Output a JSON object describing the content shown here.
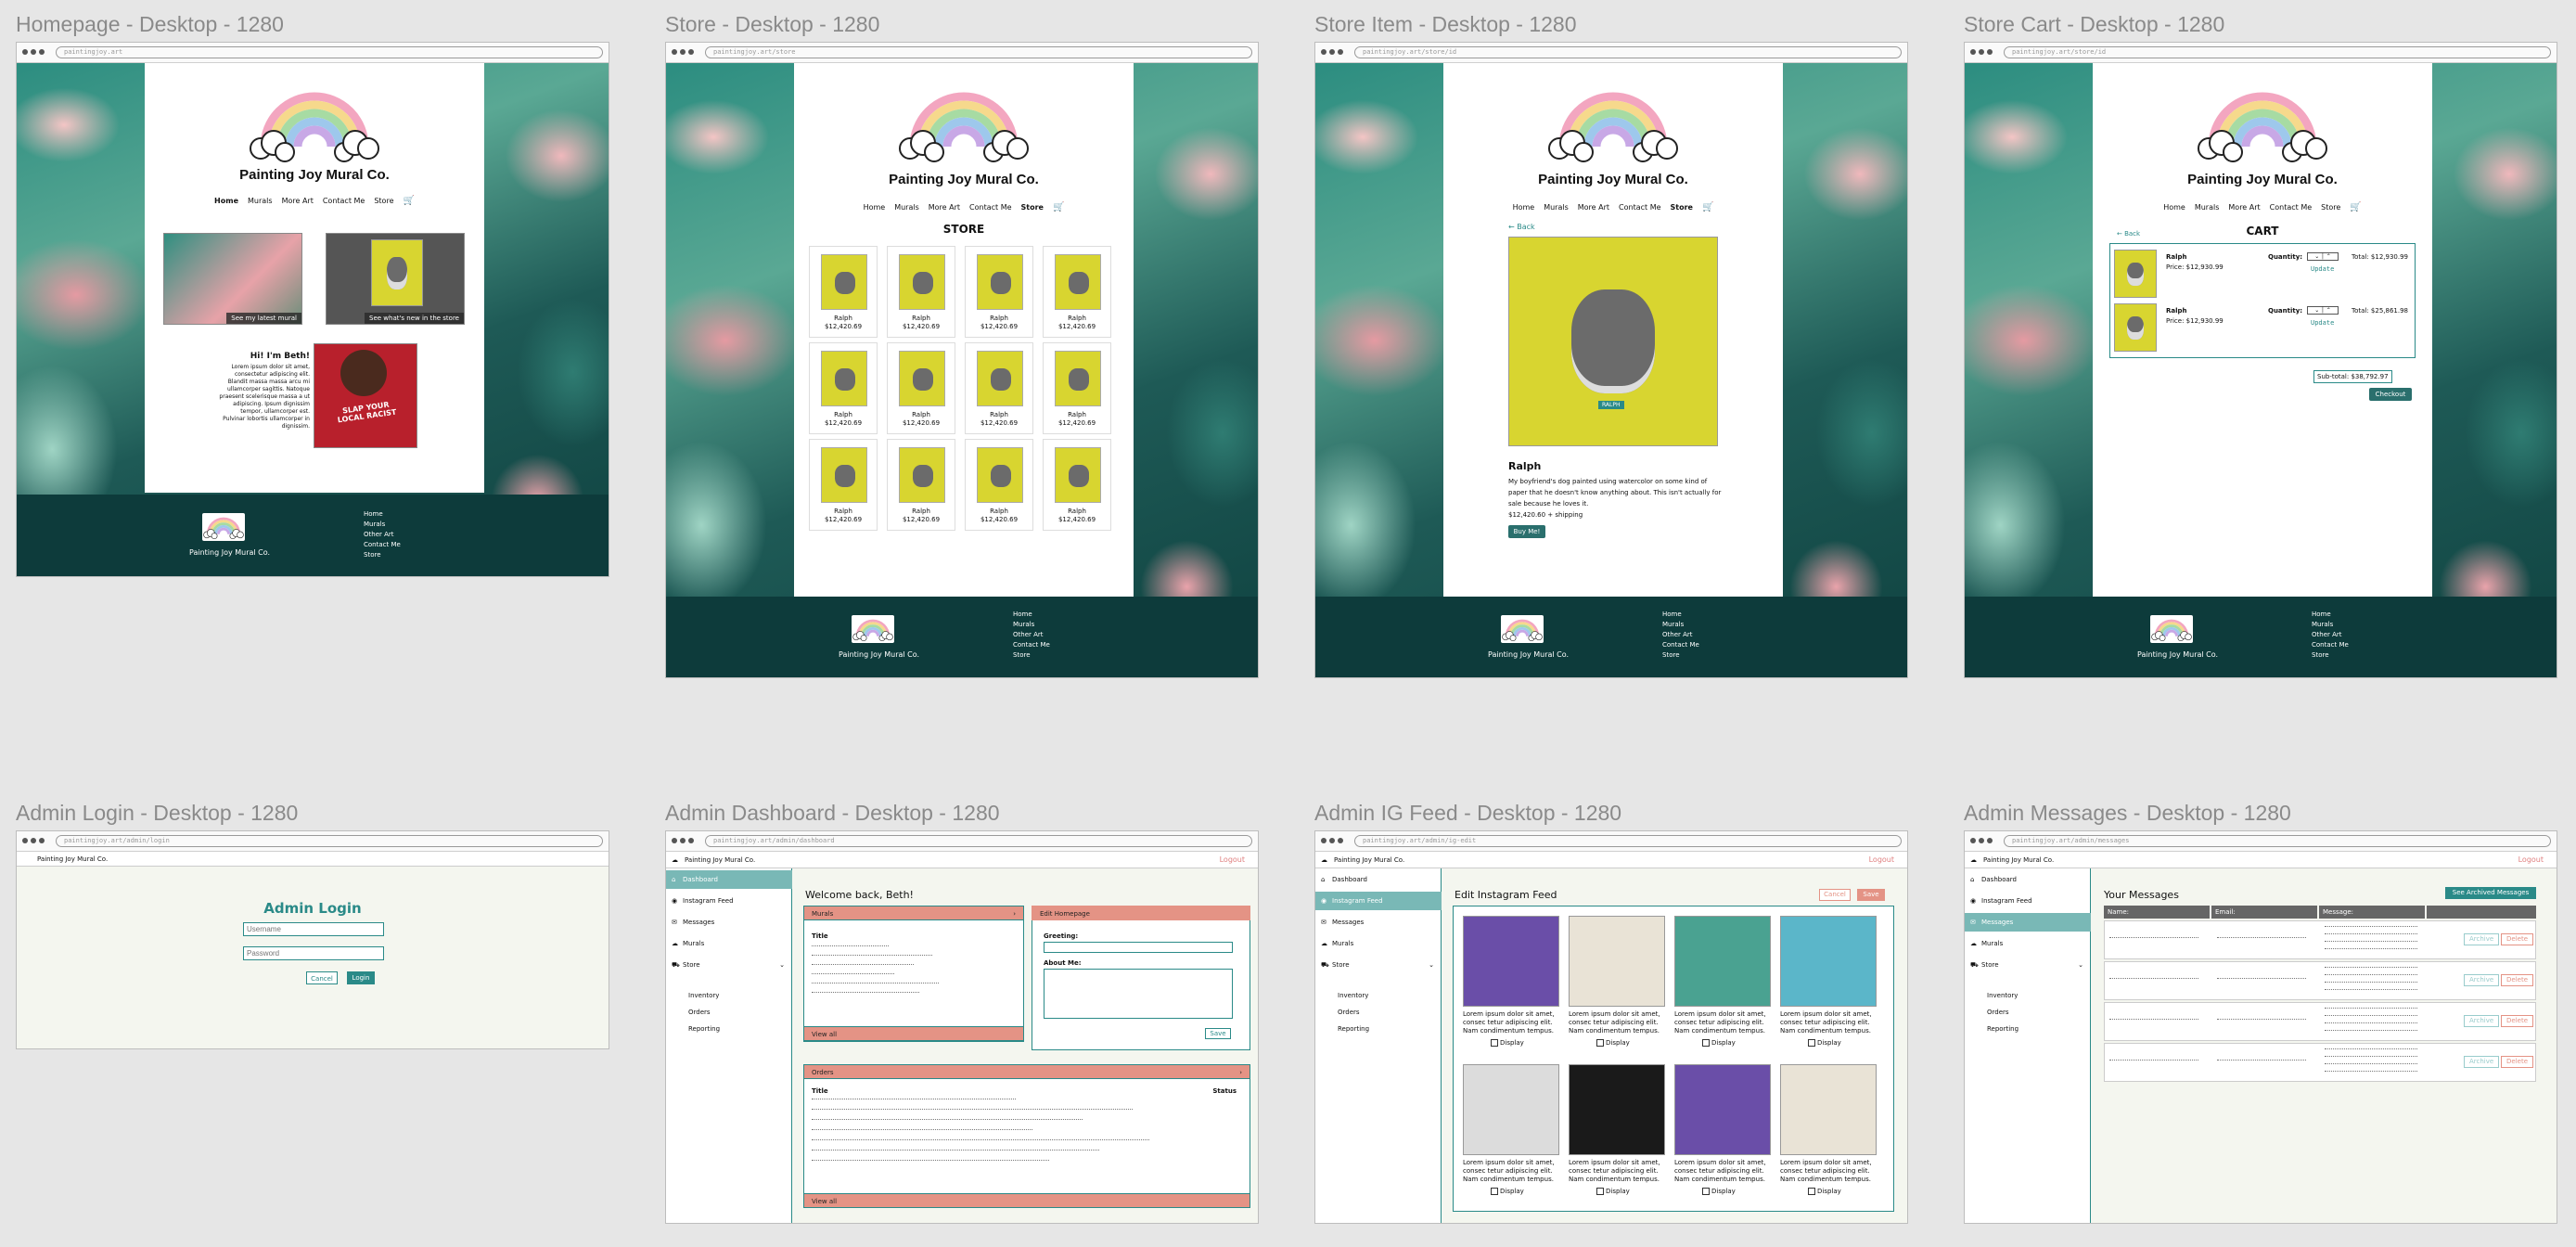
{
  "brand": "Painting Joy Mural Co.",
  "nav": [
    "Home",
    "Murals",
    "More Art",
    "Contact Me",
    "Store"
  ],
  "footer_links": [
    "Home",
    "Murals",
    "Other Art",
    "Contact Me",
    "Store"
  ],
  "frames": {
    "home": {
      "title": "Homepage - Desktop - 1280",
      "url": "paintingjoy.art"
    },
    "store": {
      "title": "Store - Desktop - 1280",
      "url": "paintingjoy.art/store"
    },
    "item": {
      "title": "Store Item - Desktop - 1280",
      "url": "paintingjoy.art/store/id"
    },
    "cart": {
      "title": "Store Cart - Desktop - 1280",
      "url": "paintingjoy.art/store/id"
    },
    "login": {
      "title": "Admin Login - Desktop - 1280",
      "url": "paintingjoy.art/admin/login"
    },
    "dash": {
      "title": "Admin Dashboard - Desktop - 1280",
      "url": "paintingjoy.art/admin/dashboard"
    },
    "ig": {
      "title": "Admin IG Feed - Desktop - 1280",
      "url": "paintingjoy.art/admin/ig-edit"
    },
    "msgs": {
      "title": "Admin Messages - Desktop - 1280",
      "url": "paintingjoy.art/admin/messages"
    }
  },
  "home": {
    "caption_left": "See my latest mural",
    "caption_right": "See what's new in the store",
    "greeting": "Hi! I'm Beth!",
    "bio": "Lorem ipsum dolor sit amet, consectetur adipiscing elit. Blandit massa massa arcu mi ullamcorper sagittis. Natoque praesent scelerisque massa a ut adipiscing. Ipsum dignissim tempor, ullamcorper est. Pulvinar lobortis ullamcorper in dignissim.",
    "shirt_text": "SLAP YOUR LOCAL RACIST"
  },
  "store": {
    "heading": "STORE",
    "item_name": "Ralph",
    "item_price": "$12,420.69"
  },
  "item": {
    "back": "← Back",
    "name": "Ralph",
    "tag": "RALPH",
    "desc": "My boyfriend's dog painted using watercolor on some kind of paper that he doesn't know anything about. This isn't actually for sale because he loves it.",
    "price": "$12,420.60 + shipping",
    "buy": "Buy Me!"
  },
  "cart": {
    "back": "← Back",
    "heading": "CART",
    "rows": [
      {
        "name": "Ralph",
        "price": "Price: $12,930.99",
        "qty_label": "Quantity:",
        "total": "Total: $12,930.99",
        "update": "Update"
      },
      {
        "name": "Ralph",
        "price": "Price: $12,930.99",
        "qty_label": "Quantity:",
        "total": "Total: $25,861.98",
        "update": "Update"
      }
    ],
    "subtotal": "Sub-total: $38,792.97",
    "checkout": "Checkout"
  },
  "login": {
    "heading": "Admin Login",
    "username_ph": "Username",
    "password_ph": "Password",
    "cancel": "Cancel",
    "login": "Login"
  },
  "admin": {
    "logout": "Logout",
    "side": [
      "Dashboard",
      "Instagram Feed",
      "Messages",
      "Murals",
      "Store"
    ],
    "sub": [
      "Inventory",
      "Orders",
      "Reporting"
    ]
  },
  "dash": {
    "welcome": "Welcome back, Beth!",
    "murals": "Murals",
    "title_col": "Title",
    "view_all": "View all",
    "edit_home": "Edit Homepage",
    "greeting_lbl": "Greeting:",
    "about_lbl": "About Me:",
    "save": "Save",
    "orders": "Orders",
    "status_col": "Status"
  },
  "ig": {
    "heading": "Edit Instagram Feed",
    "cancel": "Cancel",
    "save": "Save",
    "caption": "Lorem ipsum dolor sit amet, consec tetur adipiscing elit. Nam condimentum tempus.",
    "display": "Display"
  },
  "msgs": {
    "heading": "Your Messages",
    "archived": "See Archived Messages",
    "cols": [
      "Name:",
      "Email:",
      "Message:"
    ],
    "archive": "Archive",
    "delete": "Delete"
  },
  "colors": {
    "teal": "#2a8a88",
    "footer": "#0d3b3b",
    "salmon": "#e49385",
    "admin_bg": "#f4f6ef"
  }
}
